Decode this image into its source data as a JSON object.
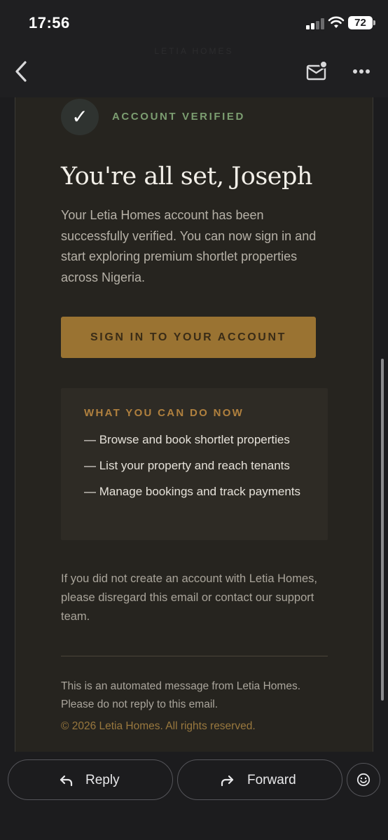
{
  "status_bar": {
    "time": "17:56",
    "battery": "72"
  },
  "header": {
    "faded_sender": "LETIA HOMES"
  },
  "email": {
    "verified_badge": "ACCOUNT VERIFIED",
    "headline": "You're all set, Joseph",
    "body": "Your Letia Homes account has been successfully verified. You can now sign in and start exploring premium shortlet properties across Nigeria.",
    "cta_label": "SIGN IN TO YOUR ACCOUNT",
    "features": {
      "title": "WHAT YOU CAN DO NOW",
      "items": [
        "— Browse and book shortlet properties",
        "— List your property and reach tenants",
        "— Manage bookings and track payments"
      ]
    },
    "note": "If you did not create an account with Letia Homes, please disregard this email or contact our support team.",
    "footer": "This is an automated message from Letia Homes. Please do not reply to this email.",
    "copyright": "© 2026 Letia Homes. All rights reserved."
  },
  "actions": {
    "reply_label": "Reply",
    "forward_label": "Forward"
  },
  "colors": {
    "accent_gold": "#9a7332",
    "verified_green": "#7c9e71",
    "card_background": "#26241f"
  },
  "icons": {
    "back": "chevron-left-icon",
    "mail": "mail-unread-icon",
    "more": "more-horizontal-icon",
    "reply": "reply-arrow-icon",
    "forward": "forward-arrow-icon",
    "emoji": "emoji-smile-icon"
  }
}
